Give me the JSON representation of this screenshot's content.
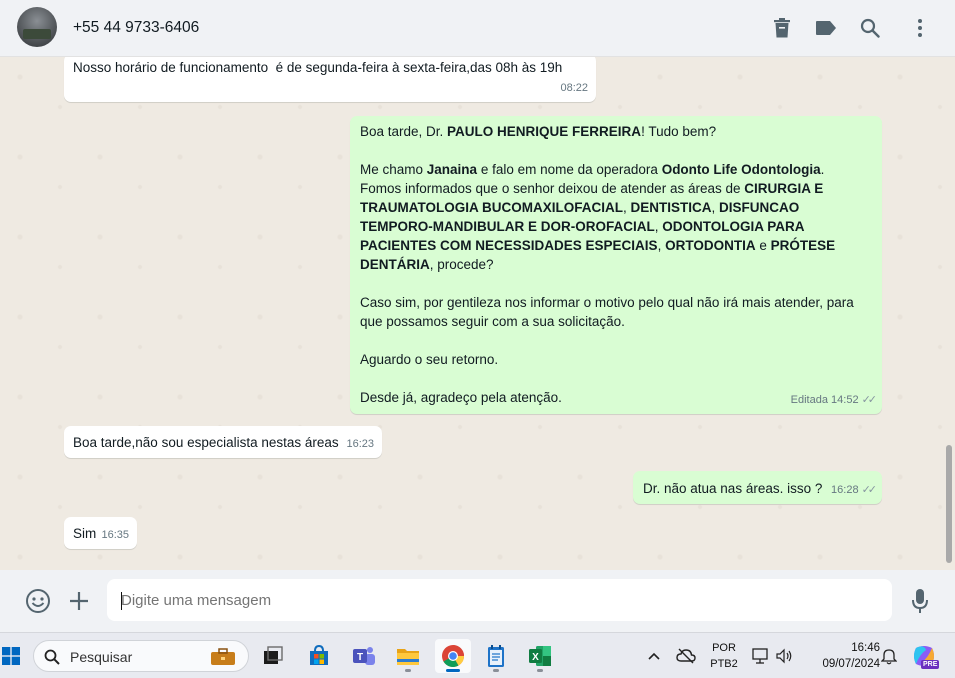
{
  "header": {
    "contact_name": "+55 44 9733-6406",
    "icons": [
      "trash-icon",
      "tag-icon",
      "search-icon",
      "menu-dots-icon"
    ]
  },
  "messages": [
    {
      "direction": "in",
      "text": "Nosso horário de funcionamento  é de segunda-feira à sexta-feira,das 08h às 19h",
      "time": "08:22"
    },
    {
      "direction": "out",
      "time": "14:52",
      "edited_label": "Editada",
      "status": "read",
      "parts": {
        "greeting_a": "Boa tarde, Dr. ",
        "doctor_name": "PAULO HENRIQUE FERREIRA",
        "greeting_b": "! Tudo bem?",
        "intro_a": "Me chamo ",
        "agent_name": "Janaina",
        "intro_b": " e falo em nome da operadora ",
        "operator": "Odonto Life Odontologia",
        "intro_c": ".",
        "informed": "Fomos informados que o senhor deixou de atender as áreas de ",
        "area1": "CIRURGIA E TRAUMATOLOGIA BUCOMAXILOFACIAL",
        "sep1": ", ",
        "area2": "DENTISTICA",
        "sep2": ", ",
        "area3": "DISFUNCAO TEMPORO-MANDIBULAR E DOR-OROFACIAL",
        "sep3": ", ",
        "area4": "ODONTOLOGIA PARA PACIENTES COM NECESSIDADES ESPECIAIS",
        "sep4": ", ",
        "area5": "ORTODONTIA",
        "sep5": " e ",
        "area6": "PRÓTESE DENTÁRIA",
        "ask": ", procede?",
        "para2": "Caso sim, por gentileza nos informar o motivo pelo qual não irá mais atender, para que possamos seguir com a sua solicitação.",
        "para3": "Aguardo o seu retorno.",
        "para4": "Desde já, agradeço pela atenção."
      }
    },
    {
      "direction": "in",
      "text": "Boa tarde,não sou especialista nestas áreas",
      "time": "16:23"
    },
    {
      "direction": "out",
      "text": "Dr. não atua nas áreas. isso ?",
      "time": "16:28",
      "status": "read"
    },
    {
      "direction": "in",
      "text": "Sim",
      "time": "16:35"
    }
  ],
  "composer": {
    "placeholder": "Digite uma mensagem",
    "icons": [
      "emoji-icon",
      "plus-icon",
      "microphone-icon"
    ]
  },
  "taskbar": {
    "search_placeholder": "Pesquisar",
    "language": "POR",
    "layout": "PTB2",
    "clock_time": "16:46",
    "clock_date": "09/07/2024",
    "copilot_badge": "PRE",
    "apps": [
      "task-view-icon",
      "store-icon",
      "teams-icon",
      "file-explorer-icon",
      "chrome-icon",
      "notepad-icon",
      "excel-icon"
    ],
    "colors": {
      "accent": "#0067c0",
      "bubble_out": "#d9fdd3",
      "bubble_in": "#ffffff",
      "chat_bg": "#efeae2"
    }
  }
}
